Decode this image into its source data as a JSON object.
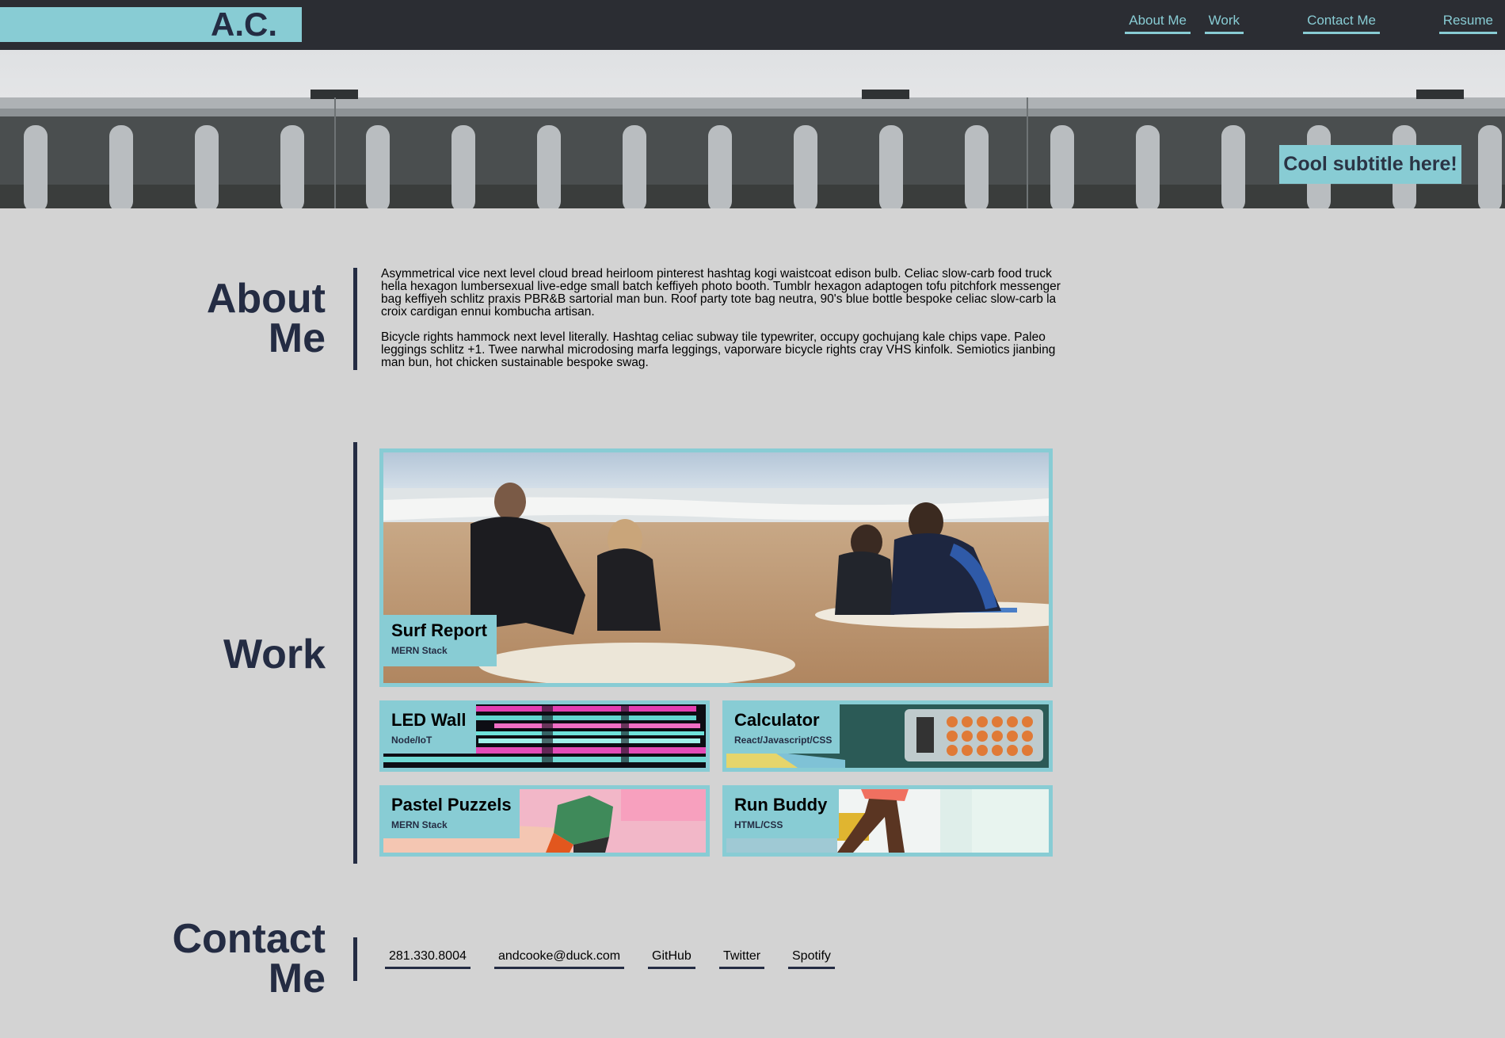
{
  "header": {
    "logo": "A.C.",
    "nav": [
      {
        "label": "About Me"
      },
      {
        "label": "Work"
      },
      {
        "label": "Contact Me"
      },
      {
        "label": "Resume"
      }
    ]
  },
  "hero": {
    "subtitle": "Cool subtitle here!"
  },
  "about": {
    "title_line1": "About",
    "title_line2": "Me",
    "paragraphs": [
      "Asymmetrical vice next level cloud bread heirloom pinterest hashtag kogi waistcoat edison bulb. Celiac slow-carb food truck hella hexagon lumbersexual live-edge small batch keffiyeh photo booth. Tumblr hexagon adaptogen tofu pitchfork messenger bag keffiyeh schlitz praxis PBR&B sartorial man bun. Roof party tote bag neutra, 90's blue bottle bespoke celiac slow-carb la croix cardigan ennui kombucha artisan.",
      "Bicycle rights hammock next level literally. Hashtag celiac subway tile typewriter, occupy gochujang kale chips vape. Paleo leggings schlitz +1. Twee narwhal microdosing marfa leggings, vaporware bicycle rights cray VHS kinfolk. Semiotics jianbing man bun, hot chicken sustainable bespoke swag."
    ]
  },
  "work": {
    "title": "Work",
    "projects": [
      {
        "title": "Surf Report",
        "stack": "MERN Stack"
      },
      {
        "title": "LED Wall",
        "stack": "Node/IoT"
      },
      {
        "title": "Calculator",
        "stack": "React/Javascript/CSS"
      },
      {
        "title": "Pastel Puzzels",
        "stack": "MERN Stack"
      },
      {
        "title": "Run Buddy",
        "stack": "HTML/CSS"
      }
    ]
  },
  "contact": {
    "title_line1": "Contact",
    "title_line2": "Me",
    "links": [
      {
        "label": "281.330.8004"
      },
      {
        "label": "andcooke@duck.com"
      },
      {
        "label": "GitHub"
      },
      {
        "label": "Twitter"
      },
      {
        "label": "Spotify"
      }
    ]
  },
  "colors": {
    "accent": "#88ccd4",
    "navy": "#242c43",
    "header_bg": "#2b2d33",
    "page_bg": "#d3d3d3"
  }
}
